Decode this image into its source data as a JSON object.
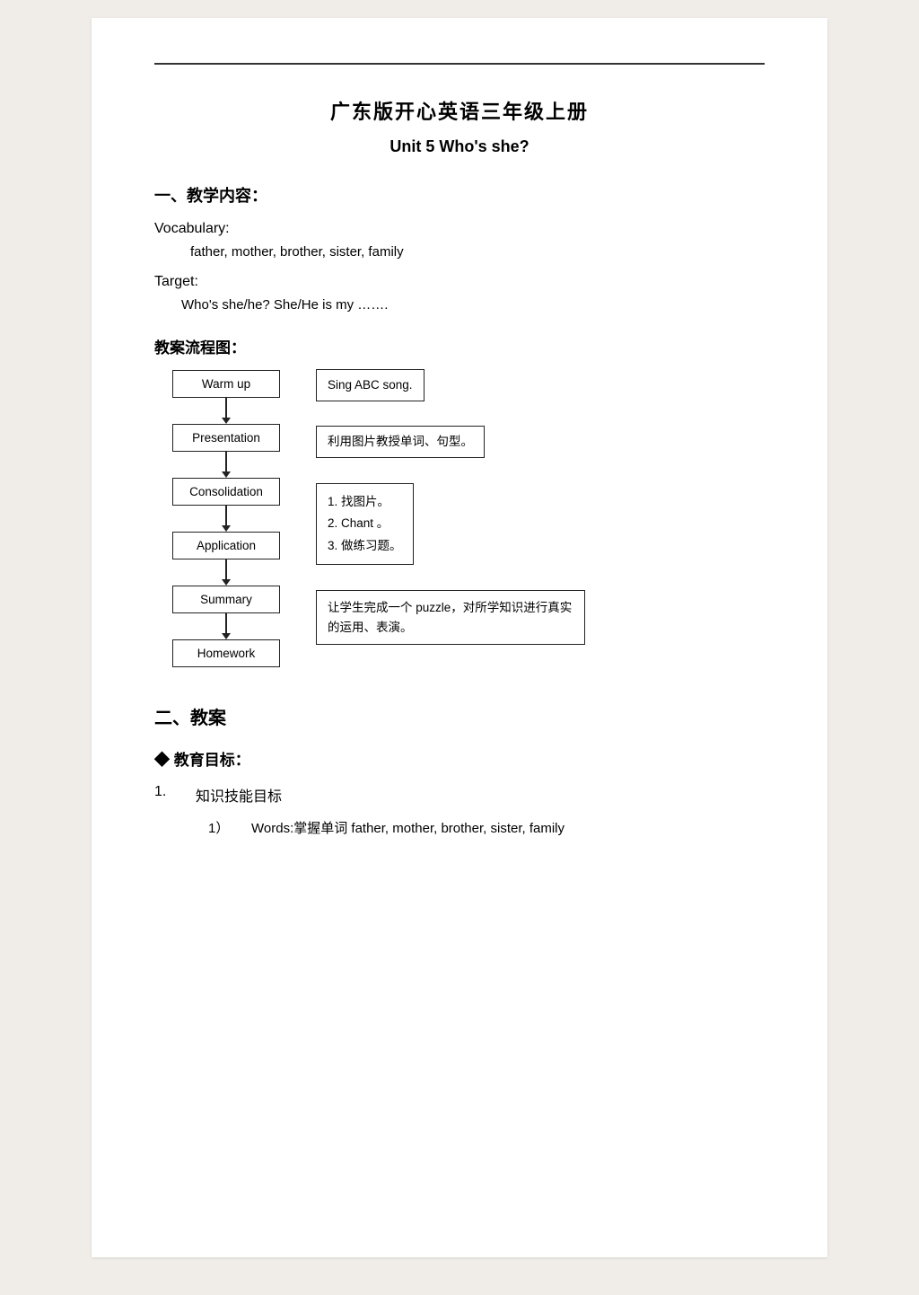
{
  "page": {
    "main_title": "广东版开心英语三年级上册",
    "sub_title": "Unit 5   Who's she?",
    "section1": {
      "heading": "一、教学内容：",
      "vocabulary_label": "Vocabulary:",
      "vocabulary_words": "father, mother, brother, sister, family",
      "target_label": "Target:",
      "target_sentence": "Who's she/he?   She/He is my …….",
      "flowchart_label": "教案流程图："
    },
    "flowchart": {
      "nodes": [
        "Warm up",
        "Presentation",
        "Consolidation",
        "Application",
        "Summary",
        "Homework"
      ],
      "right_boxes": [
        {
          "id": "warmup_box",
          "content": "Sing ABC song."
        },
        {
          "id": "presentation_box",
          "content": "利用图片教授单词、句型。"
        },
        {
          "id": "consolidation_box",
          "items": [
            "1.    找图片。",
            "2.    Chant 。",
            "3.    做练习题。"
          ]
        },
        {
          "id": "application_box",
          "content": "让学生完成一个 puzzle，对所学知识进行真实的运用、表演。"
        }
      ]
    },
    "section2": {
      "heading": "二、教案",
      "diamond_heading": "◆  教育目标：",
      "numbered_items": [
        {
          "num": "1.",
          "label": "知识技能目标",
          "sub_items": [
            {
              "subnum": "1）",
              "text": "Words:掌握单词 father, mother, brother, sister, family"
            }
          ]
        }
      ]
    }
  }
}
